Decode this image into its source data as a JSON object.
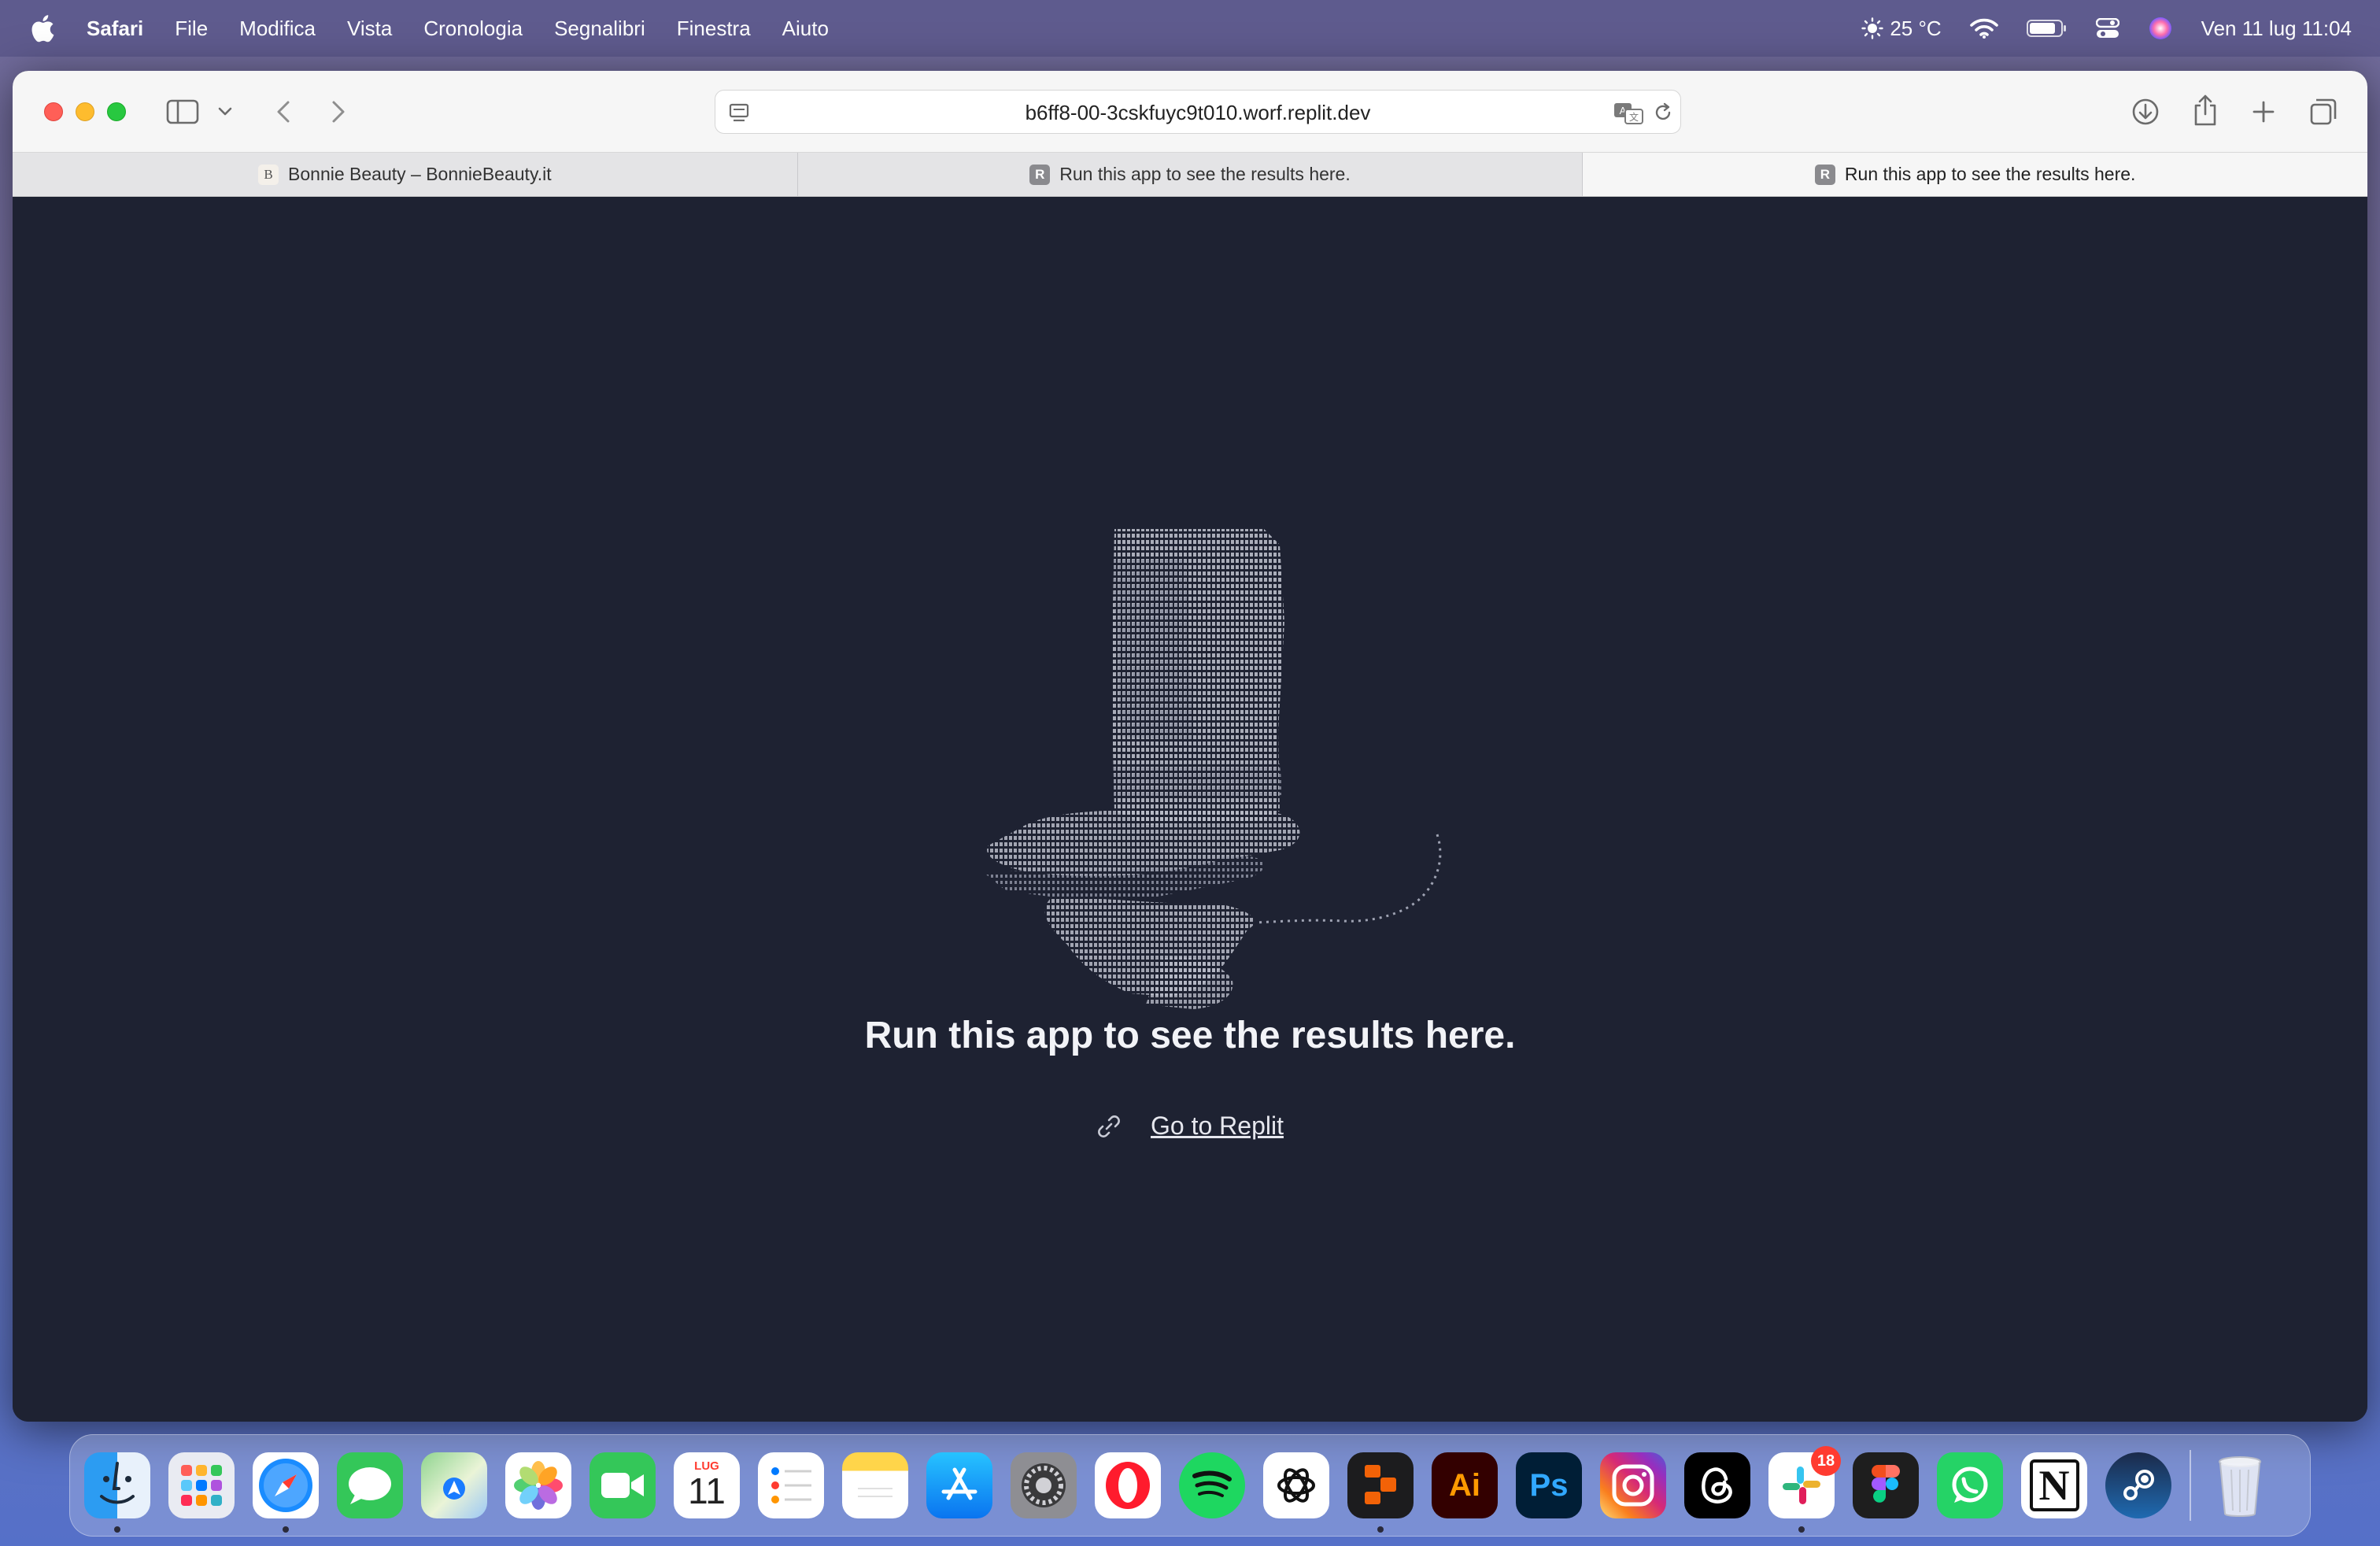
{
  "menubar": {
    "app_name": "Safari",
    "menus": [
      "File",
      "Modifica",
      "Vista",
      "Cronologia",
      "Segnalibri",
      "Finestra",
      "Aiuto"
    ],
    "weather": "25 °C",
    "datetime": "Ven 11 lug  11:04"
  },
  "browser": {
    "url": "b6ff8-00-3cskfuyc9t010.worf.replit.dev",
    "tabs": [
      {
        "favicon": "B",
        "label": "Bonnie Beauty – BonnieBeauty.it",
        "active": false
      },
      {
        "favicon": "R",
        "label": "Run this app to see the results here.",
        "active": false
      },
      {
        "favicon": "R",
        "label": "Run this app to see the results here.",
        "active": true
      }
    ]
  },
  "page": {
    "message": "Run this app to see the results here.",
    "link_label": "Go to Replit",
    "art_icon": "ascii-art-hat-icon"
  },
  "dock": {
    "calendar_month": "LUG",
    "calendar_day": "11",
    "slack_badge": "18",
    "apps": [
      "Finder",
      "Launchpad",
      "Safari",
      "Messaggi",
      "Mappe",
      "Foto",
      "FaceTime",
      "Calendario",
      "Promemoria",
      "Note",
      "App Store",
      "Impostazioni di Sistema",
      "Opera",
      "Spotify",
      "ChatGPT",
      "Replit",
      "Illustrator",
      "Photoshop",
      "Instagram",
      "Threads",
      "Slack",
      "Figma",
      "WhatsApp",
      "Notion",
      "Steam",
      "Cestino"
    ],
    "illustrator_label": "Ai",
    "photoshop_label": "Ps",
    "notion_label": "N"
  }
}
